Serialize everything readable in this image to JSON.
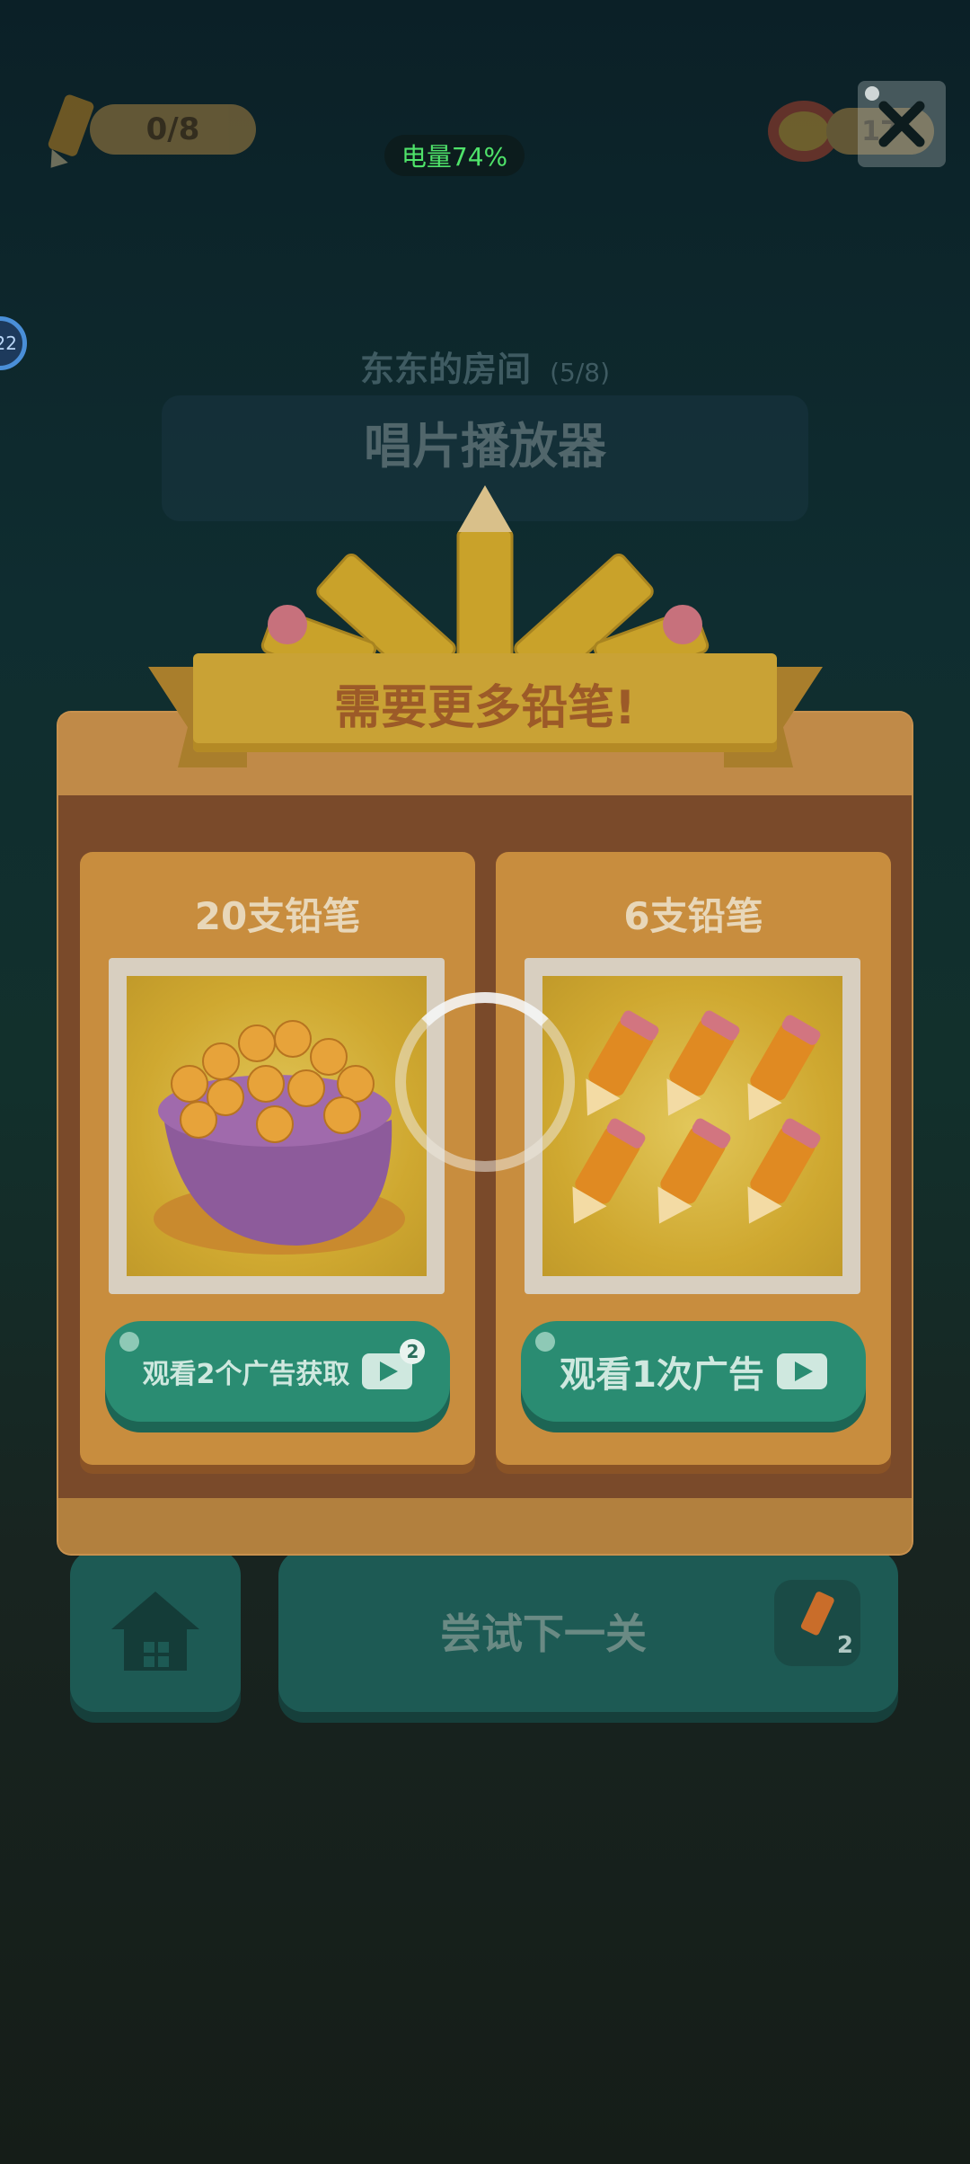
{
  "hud": {
    "pencil_count": "0/8",
    "battery": "电量74%",
    "coin_count": "17",
    "side_badge": "22"
  },
  "level": {
    "room_title": "东东的房间",
    "progress": "(5/8)",
    "item_name": "唱片播放器"
  },
  "modal": {
    "banner": "需要更多铅笔!",
    "offers": [
      {
        "title": "20支铅笔",
        "button_label": "观看2个广告获取",
        "ad_count": "2"
      },
      {
        "title": "6支铅笔",
        "button_label": "观看1次广告"
      }
    ]
  },
  "bottom": {
    "next_label": "尝试下一关",
    "next_cost": "2"
  },
  "colors": {
    "modal_brown": "#7a4a2a",
    "card_orange": "#c88d3e",
    "button_teal": "#2a8c72",
    "banner_yellow": "#c9a235"
  },
  "icons": [
    "pencil-icon",
    "coin-icon",
    "close-icon",
    "play-icon",
    "home-icon",
    "loading-spinner"
  ]
}
